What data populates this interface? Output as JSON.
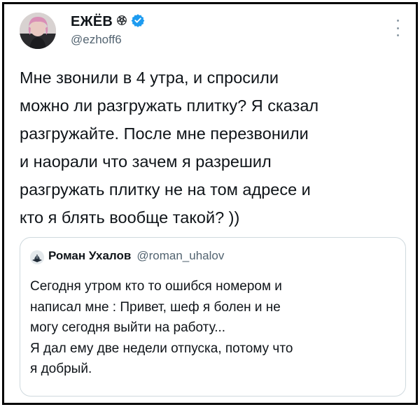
{
  "tweet": {
    "author": {
      "display_name": "ЕЖЁВ",
      "handle": "@ezhoff6",
      "name_icon": "pentagram-icon",
      "verified_icon": "verified-badge-icon",
      "verified_color": "#1d9bf0"
    },
    "text_lines": [
      "Мне звонили в 4 утра, и спросили",
      "можно ли разгружать плитку? Я сказал",
      "разгружайте. После мне перезвонили",
      "и наорали что зачем я разрешил",
      "разгружать плитку не на том адресе и",
      "кто я блять вообще такой? ))"
    ],
    "more_icon": "more-options-icon"
  },
  "quoted_tweet": {
    "author": {
      "display_name": "Роман Ухалов",
      "handle": "@roman_uhalov"
    },
    "text_lines": [
      "Сегодня утром кто то ошибся номером и",
      "написал мне : Привет, шеф я болен и не",
      "могу сегодня выйти на работу...",
      "Я дал ему две недели отпуска, потому что",
      "я добрый."
    ]
  },
  "colors": {
    "text": "#0f1419",
    "secondary": "#536471",
    "border": "#cfd9de",
    "frame": "#000000"
  }
}
